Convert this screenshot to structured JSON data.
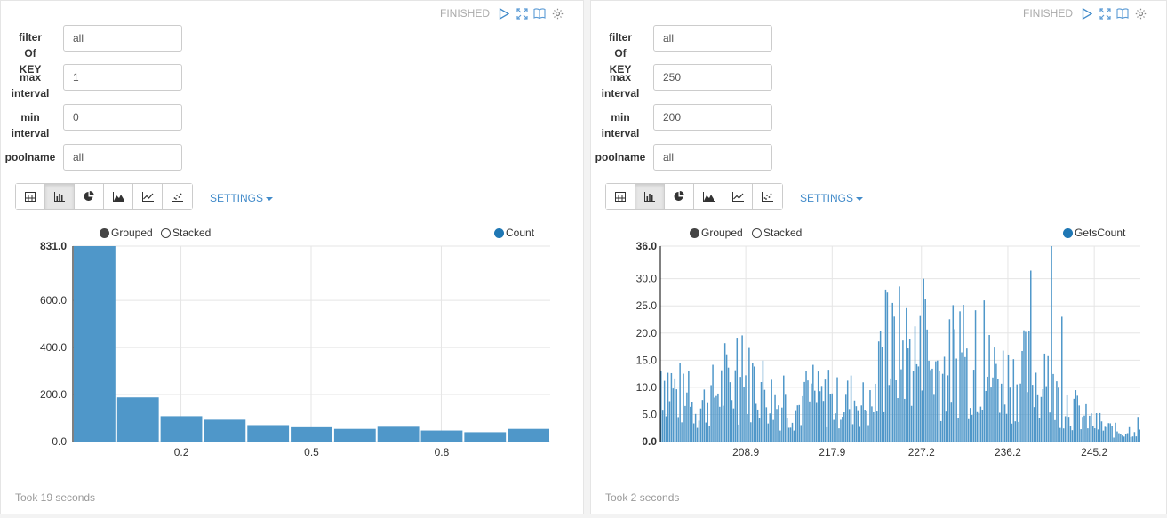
{
  "colors": {
    "bar": "#4f97c9",
    "accent": "#428bca"
  },
  "left": {
    "status": "FINISHED",
    "form": [
      {
        "label": "filter\nOf\nKEY",
        "value": "all"
      },
      {
        "label": "max\ninterval",
        "value": "1"
      },
      {
        "label": "min\ninterval",
        "value": "0"
      },
      {
        "label": "poolname",
        "value": "all"
      }
    ],
    "settings_label": "SETTINGS",
    "legend": {
      "grouped": "Grouped",
      "stacked": "Stacked",
      "series": "Count"
    },
    "took": "Took 19 seconds"
  },
  "right": {
    "status": "FINISHED",
    "form": [
      {
        "label": "filter\nOf\nKEY",
        "value": "all"
      },
      {
        "label": "max\ninterval",
        "value": "250"
      },
      {
        "label": "min\ninterval",
        "value": "200"
      },
      {
        "label": "poolname",
        "value": "all"
      }
    ],
    "settings_label": "SETTINGS",
    "legend": {
      "grouped": "Grouped",
      "stacked": "Stacked",
      "series": "GetsCount"
    },
    "took": "Took 2 seconds"
  },
  "chart_data": [
    {
      "type": "bar",
      "series": [
        {
          "name": "Count",
          "values": [
            831,
            188,
            108,
            93,
            70,
            61,
            54,
            63,
            47,
            40,
            54
          ]
        }
      ],
      "x": [
        0,
        0.1,
        0.2,
        0.3,
        0.4,
        0.5,
        0.6,
        0.7,
        0.8,
        0.9,
        1.0
      ],
      "x_tick_labels": [
        "0.2",
        "0.5",
        "0.8"
      ],
      "y_tick_labels": [
        "831.0",
        "600.0",
        "400.0",
        "200.0",
        "0.0"
      ],
      "ylim": [
        0,
        831
      ],
      "grid": true
    },
    {
      "type": "bar",
      "series": [
        {
          "name": "GetsCount",
          "profile": [
            [
              200,
              15
            ],
            [
              202,
              9
            ],
            [
              204,
              7
            ],
            [
              206,
              11
            ],
            [
              208,
              12
            ],
            [
              210,
              13
            ],
            [
              212,
              8
            ],
            [
              214,
              7
            ],
            [
              216,
              9
            ],
            [
              218,
              8
            ],
            [
              220,
              9
            ],
            [
              222,
              7
            ],
            [
              223.5,
              17
            ],
            [
              225,
              20
            ],
            [
              227,
              17
            ],
            [
              229,
              15
            ],
            [
              231,
              16
            ],
            [
              233,
              15
            ],
            [
              235,
              14
            ],
            [
              237,
              13
            ],
            [
              238.5,
              15
            ],
            [
              240,
              10
            ],
            [
              242,
              9
            ],
            [
              244,
              5
            ],
            [
              246,
              3
            ],
            [
              248,
              2
            ],
            [
              250,
              3
            ]
          ],
          "peaks": [
            [
              223.4,
              28
            ],
            [
              227.4,
              30
            ],
            [
              231.2,
              24
            ],
            [
              233.6,
              26
            ],
            [
              238.6,
              31.5
            ],
            [
              240.7,
              36
            ],
            [
              241.8,
              23
            ]
          ]
        }
      ],
      "x_tick_labels": [
        "208.9",
        "217.9",
        "227.2",
        "236.2",
        "245.2"
      ],
      "x_tick_values": [
        208.9,
        217.9,
        227.2,
        236.2,
        245.2
      ],
      "y_tick_labels": [
        "36.0",
        "30.0",
        "25.0",
        "20.0",
        "15.0",
        "10.0",
        "5.0",
        "0.0"
      ],
      "y_tick_values": [
        36,
        30,
        25,
        20,
        15,
        10,
        5,
        0
      ],
      "xlim": [
        200,
        250
      ],
      "ylim": [
        0,
        36
      ],
      "grid": true
    }
  ]
}
